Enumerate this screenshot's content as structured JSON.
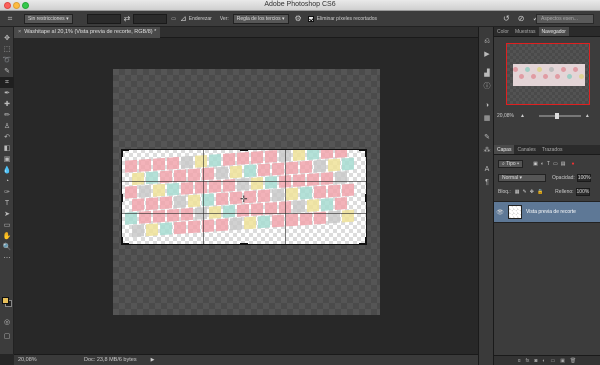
{
  "window": {
    "title": "Adobe Photoshop CS6"
  },
  "options_bar": {
    "ratio_dropdown": "Sin restricciones",
    "enderezar_label": "Enderezar",
    "ver_label": "Ver:",
    "view_dropdown": "Regla de los tercios",
    "delete_pixels_label": "Eliminar píxeles recortados",
    "search_placeholder": "Aspectos esen..."
  },
  "document": {
    "tab_label": "Washitape al 20,1% (Vista previa de recorte, RGB/8) *",
    "close_symbol": "×"
  },
  "status_bar": {
    "zoom": "20,08%",
    "doc_info": "Doc: 23,8 MB/6 bytes",
    "arrow": "▶"
  },
  "navigator_panel": {
    "tabs": [
      "Color",
      "Muestras",
      "Navegador"
    ],
    "active_tab": "Navegador",
    "zoom": "20,08%"
  },
  "layers_panel": {
    "tabs": [
      "Capas",
      "Canales",
      "Trazados"
    ],
    "active_tab": "Capas",
    "kind_filter": "Tipo",
    "blend_mode": "Normal",
    "opacity_label": "Opacidad:",
    "opacity_value": "100%",
    "lock_label": "Bloq.:",
    "fill_label": "Relleno:",
    "fill_value": "100%",
    "layer_name": "Vista previa de recorte",
    "footer_icons": [
      "ɑ",
      "fx",
      "◙",
      "◐",
      "▭",
      "▣",
      "🗑"
    ]
  },
  "colors": {
    "foreground": "#e8c05a",
    "background": "#222222",
    "heart_pink": "#f1a5ad",
    "heart_mint": "#a8dcd2",
    "heart_yellow": "#efe29a",
    "heart_gray": "#c9c9c9"
  }
}
